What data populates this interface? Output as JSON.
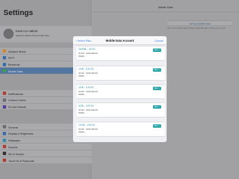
{
  "status": {
    "device": "iPad",
    "time": "16:20",
    "battery": "100%"
  },
  "settings": {
    "title": "Settings",
    "profile": {
      "name": "Karim Le Vallois",
      "subtitle": "Apple ID, iCloud, iTunes & App Store"
    },
    "group1": [
      {
        "label": "Airplane Mode",
        "icon": "airplane-icon",
        "color": "#c98a3a"
      },
      {
        "label": "Wi-Fi",
        "icon": "wifi-icon",
        "color": "#3a6ea8"
      },
      {
        "label": "Bluetooth",
        "icon": "bluetooth-icon",
        "color": "#3a6ea8"
      },
      {
        "label": "Mobile Data",
        "icon": "antenna-icon",
        "color": "#3f9a52",
        "selected": true
      }
    ],
    "group2": [
      {
        "label": "Notifications",
        "icon": "notifications-icon",
        "color": "#b0413a"
      },
      {
        "label": "Control Centre",
        "icon": "control-centre-icon",
        "color": "#6e6e72"
      },
      {
        "label": "Do Not Disturb",
        "icon": "moon-icon",
        "color": "#5a3f9a"
      }
    ],
    "group3": [
      {
        "label": "General",
        "icon": "gear-icon",
        "color": "#6e6e72"
      },
      {
        "label": "Display & Brightness",
        "icon": "brightness-icon",
        "color": "#3a6ea8"
      },
      {
        "label": "Wallpaper",
        "icon": "wallpaper-icon",
        "color": "#3a8aa8"
      },
      {
        "label": "Sounds",
        "icon": "speaker-icon",
        "color": "#b0413a"
      },
      {
        "label": "Siri & Search",
        "icon": "siri-icon",
        "color": "#333338"
      },
      {
        "label": "Touch ID & Passcode",
        "icon": "fingerprint-icon",
        "color": "#b0413a"
      }
    ]
  },
  "mobile_data": {
    "title": "Mobile Data",
    "setup_button": "Set Up Mobile Data",
    "note": "Tap to set up mobile data, purchase mobile data plans or check your account."
  },
  "modal": {
    "back_label": "Select Plan",
    "title": "Mobile Data Account",
    "cancel_label": "Cancel",
    "plans": [
      {
        "name": "300MB – £5.00",
        "info": "30 DAY · DATA ADD-ON",
        "details": "Details",
        "buy_label": "BUY"
      },
      {
        "name": "1GB – £10.00",
        "info": "30 DAY · DATA ADD-ON",
        "details": "Details",
        "buy_label": "BUY"
      },
      {
        "name": "2GB – £15.00",
        "info": "30 DAY · DATA ADD-ON",
        "details": "Details",
        "buy_label": "BUY"
      },
      {
        "name": "4GB – £20.00",
        "info": "30 DAY · DATA ADD-ON",
        "details": "Details",
        "buy_label": "BUY"
      },
      {
        "name": "10GB – £30.00",
        "info": "30 DAY · DATA ADD-ON",
        "details": "Details",
        "buy_label": "BUY"
      }
    ]
  }
}
